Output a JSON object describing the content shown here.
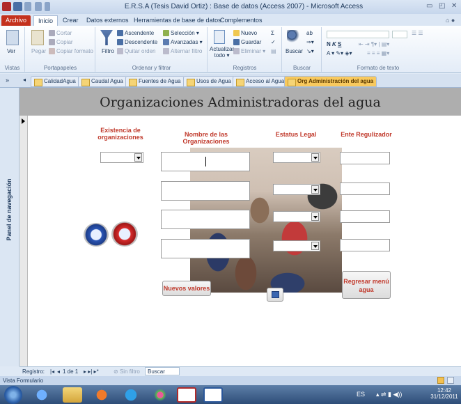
{
  "window": {
    "title": "E.R.S.A (Tesis David Ortiz) : Base de datos (Access 2007) - Microsoft Access"
  },
  "menu_tabs": [
    "Archivo",
    "Inicio",
    "Crear",
    "Datos externos",
    "Herramientas de base de datos",
    "Complementos"
  ],
  "ribbon": {
    "vistas": {
      "ver": "Ver",
      "label": "Vistas"
    },
    "portapapeles": {
      "pegar": "Pegar",
      "cortar": "Cortar",
      "copiar": "Copiar",
      "copiar_formato": "Copiar formato",
      "label": "Portapapeles"
    },
    "ordenar": {
      "filtro": "Filtro",
      "ascendente": "Ascendente",
      "descendente": "Descendente",
      "quitar_orden": "Quitar orden",
      "seleccion": "Selección",
      "avanzadas": "Avanzadas",
      "alternar_filtro": "Alternar filtro",
      "label": "Ordenar y filtrar"
    },
    "registros": {
      "actualizar": "Actualizar",
      "todo": "todo",
      "nuevo": "Nuevo",
      "guardar": "Guardar",
      "eliminar": "Eliminar",
      "label": "Registros"
    },
    "buscar": {
      "buscar": "Buscar",
      "label": "Buscar"
    },
    "formato": {
      "label": "Formato de texto"
    }
  },
  "doc_tabs": [
    "CalidadAgua",
    "Caudal Agua",
    "Fuentes de Agua",
    "Usos de Agua",
    "Acceso al Agua",
    "Org Administración del agua"
  ],
  "nav_pane": {
    "label": "Panel de navegación"
  },
  "form": {
    "title": "Organizaciones Administradoras del agua",
    "headers": {
      "existencia": "Existencia de organizaciones",
      "nombre": "Nombre de las Organizaciones",
      "estatus": "Estatus Legal",
      "ente": "Ente Regulizador"
    },
    "buttons": {
      "nuevos": "Nuevos valores",
      "regresar": "Regresar menú agua"
    }
  },
  "record_nav": {
    "registro": "Registro:",
    "position": "1 de 1",
    "filter": "Sin filtro",
    "search": "Buscar"
  },
  "status": {
    "view": "Vista Formulario"
  },
  "taskbar": {
    "lang": "ES",
    "time": "12:42",
    "date": "31/12/2011"
  }
}
